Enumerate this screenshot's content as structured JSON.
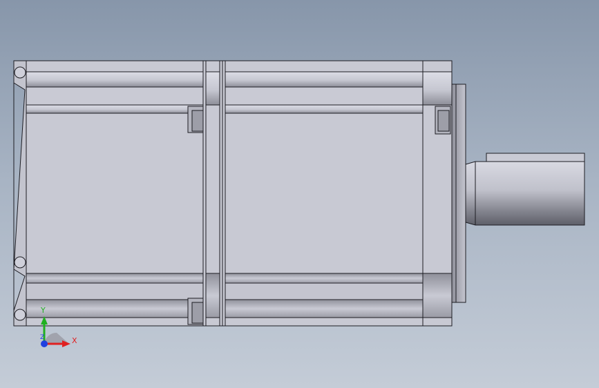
{
  "viewport": {
    "view": "front",
    "background_colors": [
      "#8796aa",
      "#c4ccd7"
    ]
  },
  "model": {
    "part": "servo-motor",
    "body_color": "#c8c9d3",
    "shaft_color": "#b9bac4",
    "edge_color": "#1c1c22"
  },
  "triad": {
    "x_label": "X",
    "y_label": "Y",
    "z_label": "Z",
    "x_color": "#e02020",
    "y_color": "#20b020",
    "z_color": "#2040e0"
  }
}
